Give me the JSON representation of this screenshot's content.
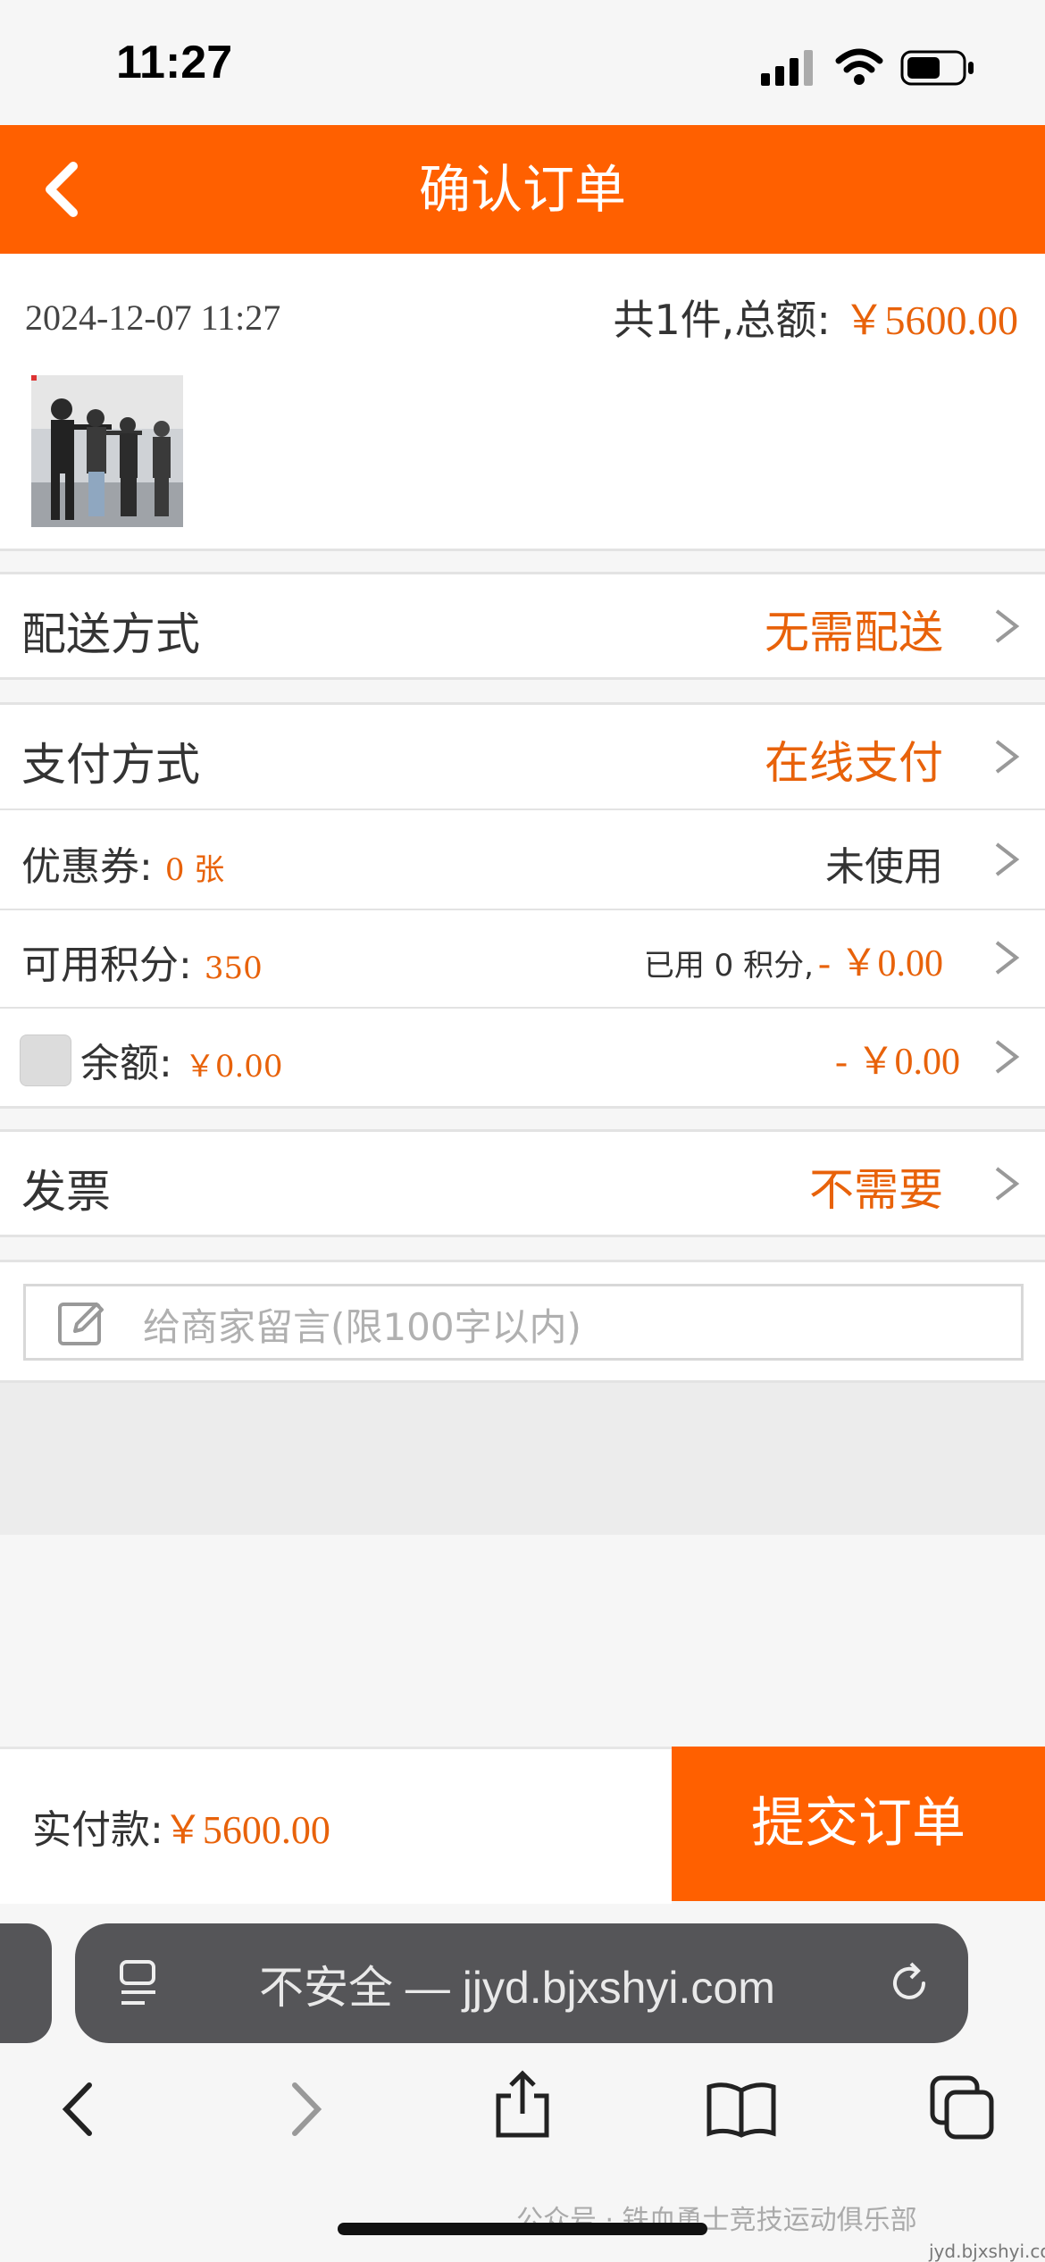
{
  "status_bar": {
    "time": "11:27"
  },
  "header": {
    "title": "确认订单"
  },
  "order": {
    "date": "2024-12-07 11:27",
    "summary_prefix": "共1件,总额: ",
    "total": "￥5600.00"
  },
  "delivery": {
    "label": "配送方式",
    "value": "无需配送"
  },
  "payment": {
    "label": "支付方式",
    "value": "在线支付"
  },
  "coupon": {
    "label": "优惠券:",
    "count": "0 张",
    "value": "未使用"
  },
  "points": {
    "label": "可用积分:",
    "count": "350",
    "used_prefix": "已用 0 积分,",
    "used_value": "- ￥0.00"
  },
  "balance": {
    "label": "余额:",
    "count": "￥0.00",
    "value": "- ￥0.00",
    "checked": false
  },
  "invoice": {
    "label": "发票",
    "value": "不需要"
  },
  "note": {
    "placeholder": "给商家留言(限100字以内)"
  },
  "bottom": {
    "pay_label": "实付款:",
    "pay_value": "￥5600.00",
    "submit": "提交订单"
  },
  "browser": {
    "url": "不安全 — jjyd.bjxshyi.com"
  },
  "watermark": {
    "text": "公众号 · 铁血勇士竞技运动俱乐部",
    "site": "jyd.bjxshyi.com"
  },
  "colors": {
    "accent": "#ff6000",
    "orange_text": "#e8620a"
  }
}
